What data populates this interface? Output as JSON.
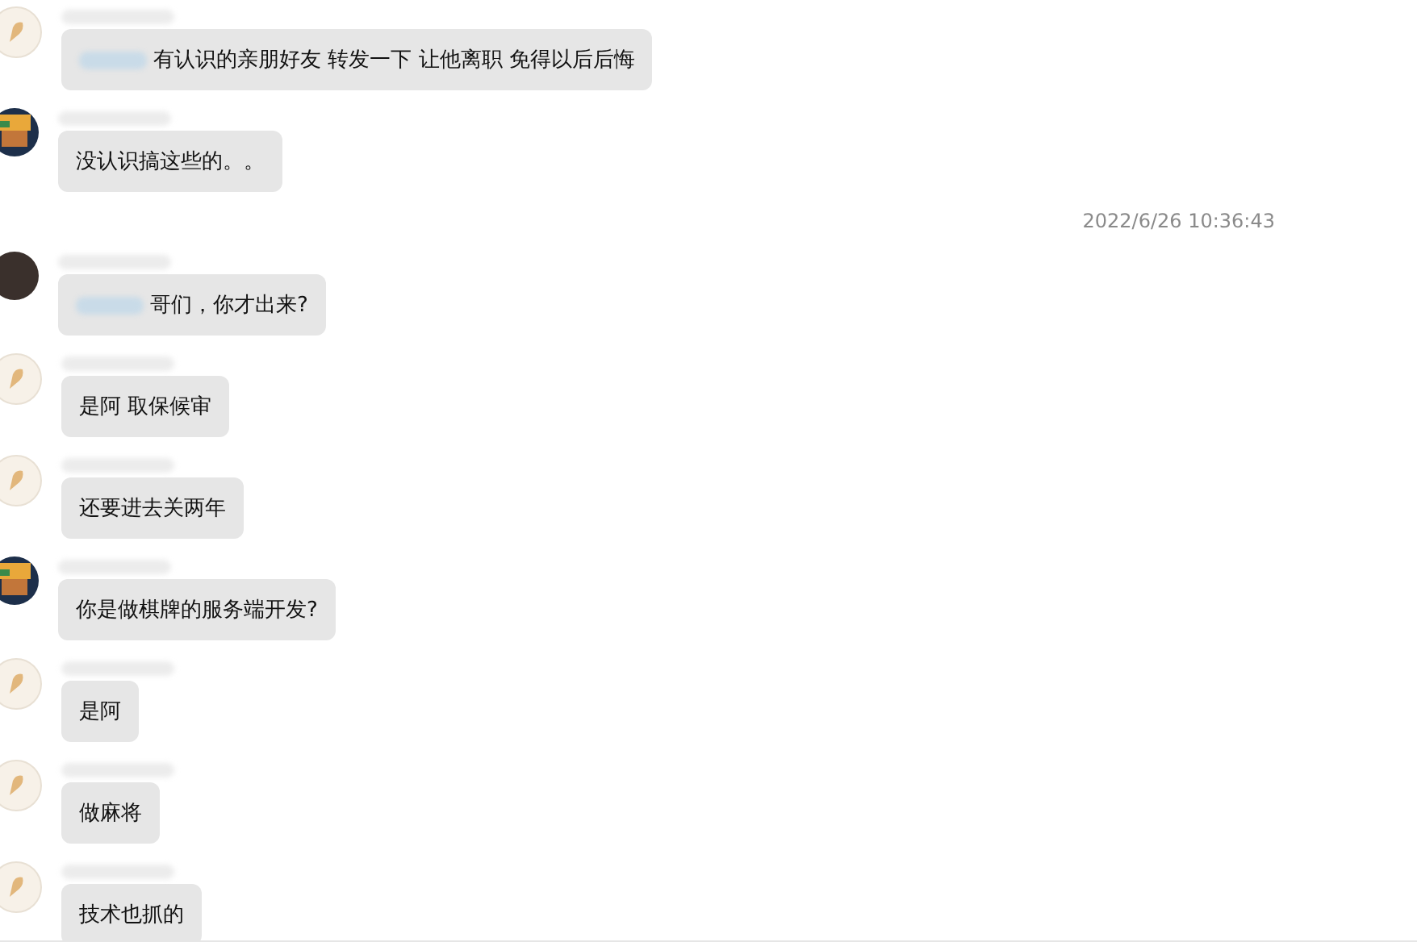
{
  "messages": [
    {
      "kind": "message",
      "avatar": {
        "kind": "sticker"
      },
      "mention_redacted": true,
      "text": "有认识的亲朋好友 转发一下 让他离职 免得以后后悔"
    },
    {
      "kind": "message",
      "avatar": {
        "kind": "cartoon"
      },
      "mention_redacted": false,
      "text": "没认识搞这些的。。"
    },
    {
      "kind": "timestamp",
      "text": "2022/6/26 10:36:43"
    },
    {
      "kind": "message",
      "avatar": {
        "kind": "photo"
      },
      "mention_redacted": true,
      "text": "哥们，你才出来?"
    },
    {
      "kind": "message",
      "avatar": {
        "kind": "sticker"
      },
      "mention_redacted": false,
      "text": "是阿 取保候审"
    },
    {
      "kind": "message",
      "avatar": {
        "kind": "sticker"
      },
      "mention_redacted": false,
      "text": "还要进去关两年"
    },
    {
      "kind": "message",
      "avatar": {
        "kind": "cartoon"
      },
      "mention_redacted": false,
      "text": "你是做棋牌的服务端开发?"
    },
    {
      "kind": "message",
      "avatar": {
        "kind": "sticker"
      },
      "mention_redacted": false,
      "text": "是阿"
    },
    {
      "kind": "message",
      "avatar": {
        "kind": "sticker"
      },
      "mention_redacted": false,
      "text": "做麻将"
    },
    {
      "kind": "message",
      "avatar": {
        "kind": "sticker"
      },
      "mention_redacted": false,
      "text": "技术也抓的"
    }
  ]
}
